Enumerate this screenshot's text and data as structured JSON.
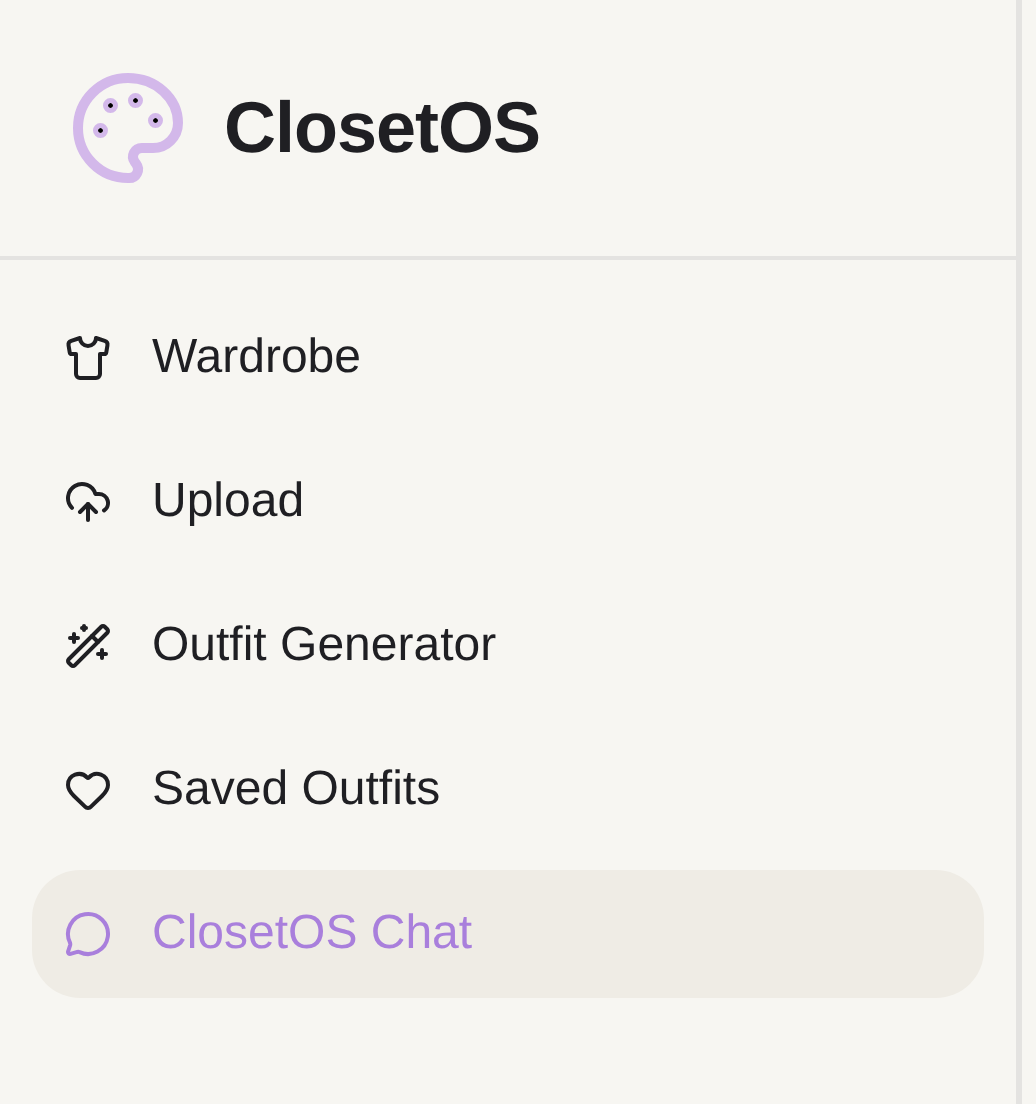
{
  "brand": {
    "name": "ClosetOS"
  },
  "nav": [
    {
      "label": "Wardrobe",
      "kind": "wardrobe",
      "selected": false
    },
    {
      "label": "Upload",
      "kind": "upload",
      "selected": false
    },
    {
      "label": "Outfit Generator",
      "kind": "generator",
      "selected": false
    },
    {
      "label": "Saved Outfits",
      "kind": "saved",
      "selected": false
    },
    {
      "label": "ClosetOS Chat",
      "kind": "chat",
      "selected": true
    }
  ]
}
